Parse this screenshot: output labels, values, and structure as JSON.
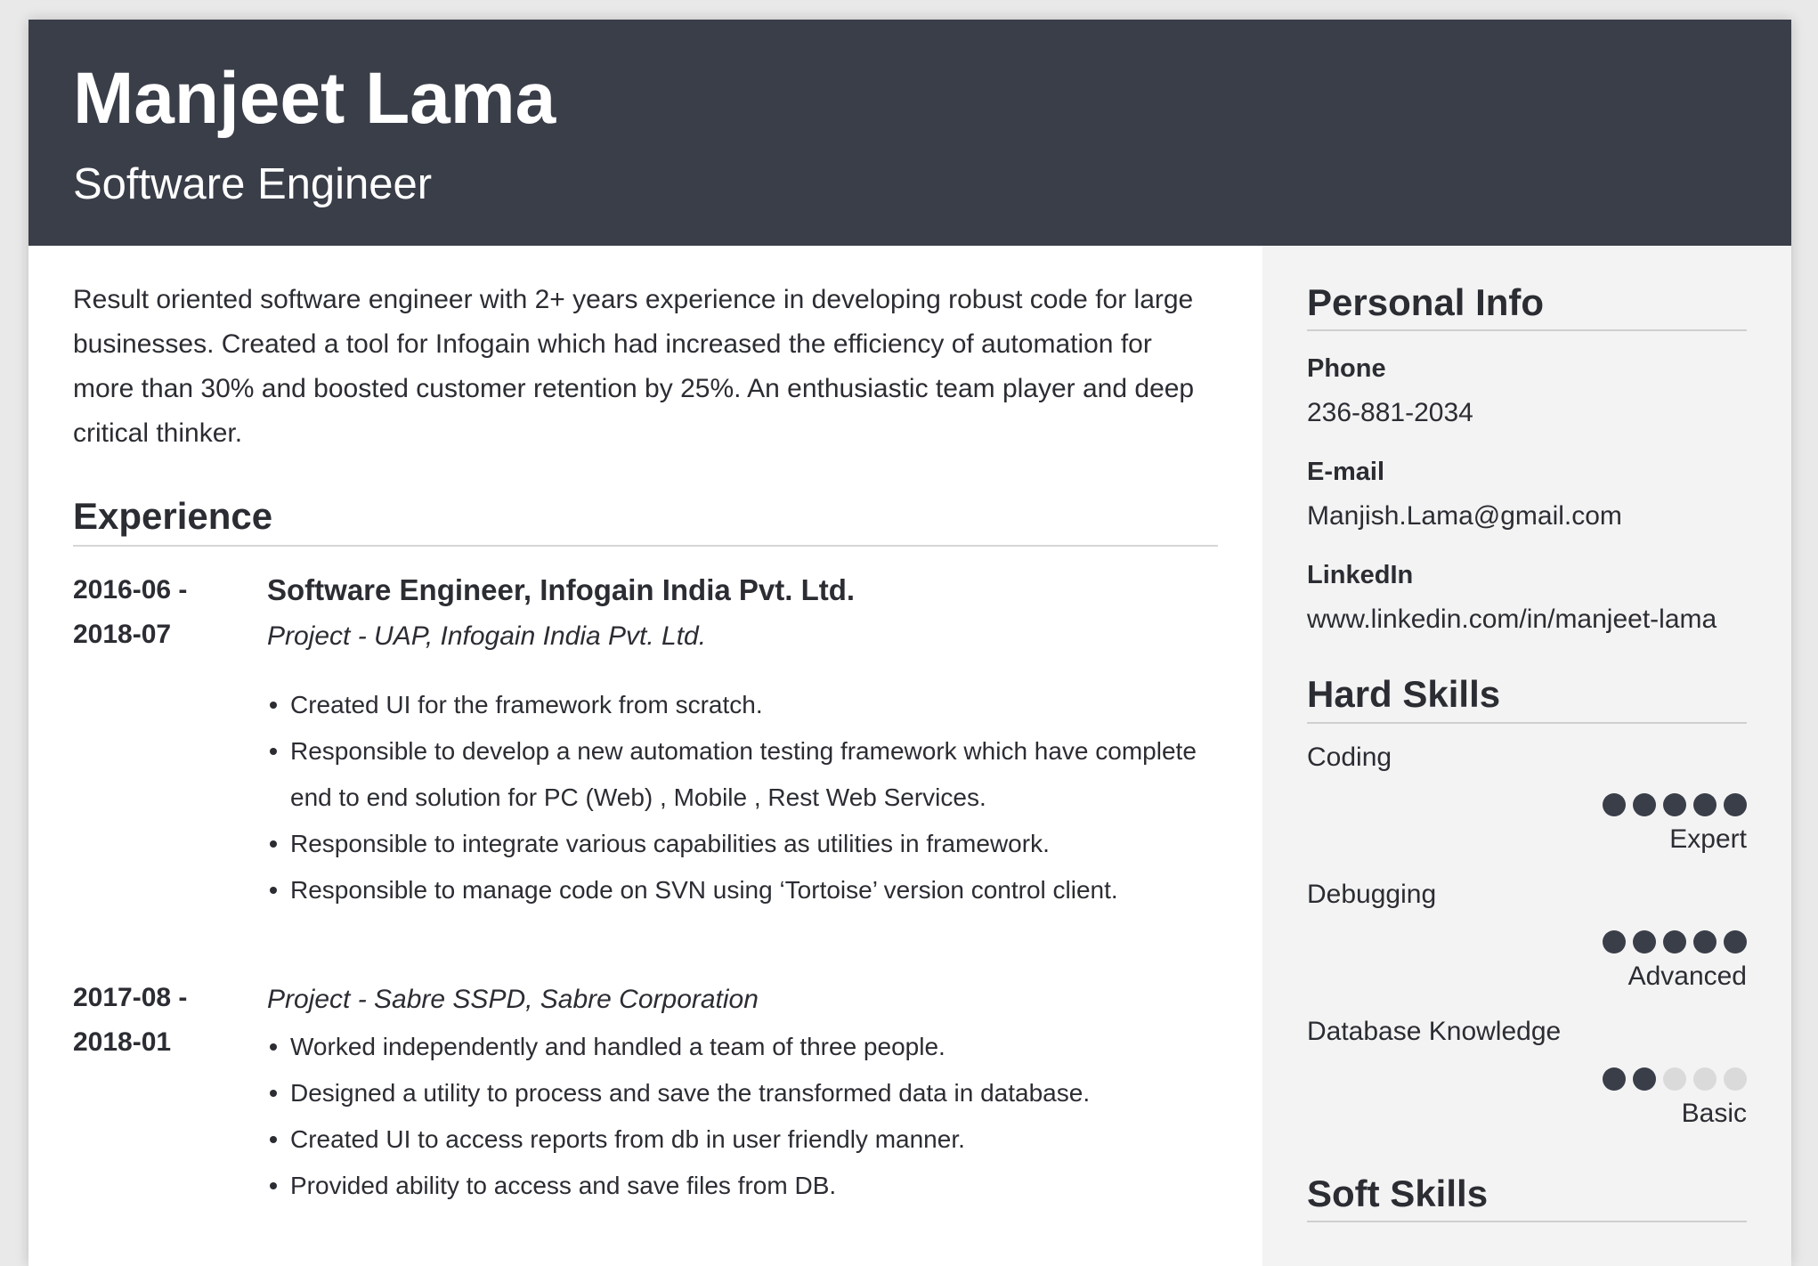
{
  "header": {
    "name": "Manjeet Lama",
    "title": "Software Engineer"
  },
  "summary": "Result oriented software engineer with 2+ years experience in developing robust code for large businesses. Created a tool for Infogain which had increased the efficiency of automation for more than 30% and boosted customer retention by 25%. An enthusiastic team player and deep critical thinker.",
  "experience": {
    "heading": "Experience",
    "entries": [
      {
        "date_start": "2016-06 -",
        "date_end": "2018-07",
        "role": "Software Engineer, Infogain India Pvt. Ltd.",
        "project": "Project - UAP, Infogain India Pvt. Ltd.",
        "bullets": [
          "Created UI for the framework from scratch.",
          "Responsible to develop a new automation testing framework which have complete end to end solution for PC (Web) , Mobile , Rest Web Services.",
          "Responsible to integrate various capabilities as utilities in framework.",
          "Responsible to manage code on SVN using ‘Tortoise’ version control client."
        ]
      },
      {
        "date_start": "2017-08 -",
        "date_end": "2018-01",
        "project": "Project - Sabre SSPD,  Sabre Corporation",
        "bullets": [
          "Worked independently and handled a team of three people.",
          "Designed a utility to process and save the transformed data in database.",
          "Created UI to access reports from db in user friendly manner.",
          "Provided ability to access and save files from DB."
        ]
      }
    ]
  },
  "sidebar": {
    "personal_info": {
      "heading": "Personal Info",
      "phone_label": "Phone",
      "phone": "236-881-2034",
      "email_label": "E-mail",
      "email": "Manjish.Lama@gmail.com",
      "linkedin_label": "LinkedIn",
      "linkedin": "www.linkedin.com/in/manjeet-lama"
    },
    "hard_skills": {
      "heading": "Hard Skills",
      "items": [
        {
          "name": "Coding",
          "rating": 5,
          "max": 5,
          "level": "Expert"
        },
        {
          "name": "Debugging",
          "rating": 5,
          "max": 5,
          "level": "Advanced"
        },
        {
          "name": "Database Knowledge",
          "rating": 2,
          "max": 5,
          "level": "Basic"
        }
      ]
    },
    "soft_skills": {
      "heading": "Soft Skills"
    }
  },
  "colors": {
    "header_bg": "#3a3e49",
    "sidebar_bg": "#f3f3f3",
    "dot_on": "#3a3e49",
    "dot_off": "#dadada"
  }
}
